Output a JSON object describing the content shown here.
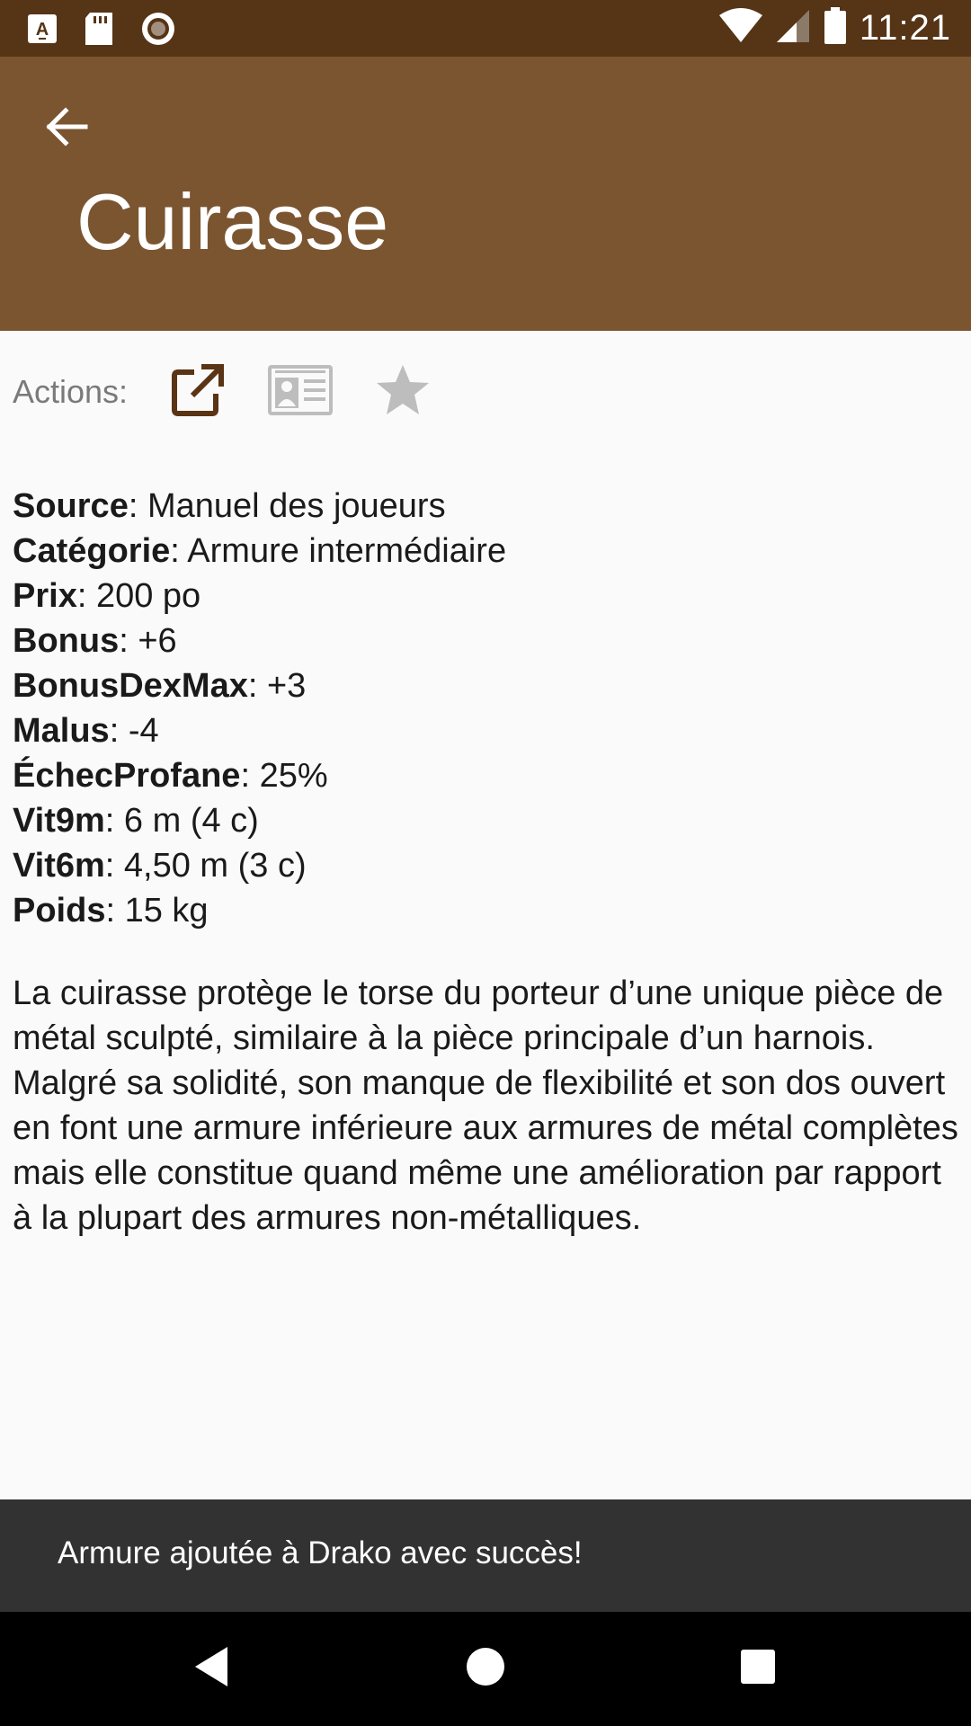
{
  "status_bar": {
    "time": "11:21",
    "left_icons": [
      "a-notification-icon",
      "sd-card-icon",
      "record-icon"
    ],
    "right_icons": [
      "wifi-icon",
      "signal-icon",
      "battery-icon"
    ]
  },
  "app_bar": {
    "title": "Cuirasse",
    "back_icon": "arrow-back-icon",
    "color": "#7b5530"
  },
  "actions": {
    "label": "Actions:",
    "buttons": [
      {
        "icon": "open-external-icon"
      },
      {
        "icon": "id-card-icon"
      },
      {
        "icon": "star-icon"
      }
    ]
  },
  "details": [
    {
      "label": "Source",
      "value": ": Manuel des joueurs"
    },
    {
      "label": "Catégorie",
      "value": ": Armure intermédiaire"
    },
    {
      "label": "Prix",
      "value": ": 200 po"
    },
    {
      "label": "Bonus",
      "value": ": +6"
    },
    {
      "label": "BonusDexMax",
      "value": ": +3"
    },
    {
      "label": "Malus",
      "value": ": -4"
    },
    {
      "label": "ÉchecProfane",
      "value": ": 25%"
    },
    {
      "label": "Vit9m",
      "value": ": 6 m (4 c)"
    },
    {
      "label": "Vit6m",
      "value": ": 4,50 m (3 c)"
    },
    {
      "label": "Poids",
      "value": ": 15 kg"
    }
  ],
  "description": "La cuirasse protège le torse du porteur d’une unique pièce de métal sculpté, similaire à la pièce principale d’un harnois. Malgré sa solidité, son manque de flexibilité et son dos ouvert en font une armure inférieure aux armures de métal complètes mais elle constitue quand même une amélioration par rapport à la plupart des armures non-métalliques.",
  "snackbar": {
    "message": "Armure ajoutée à Drako avec succès!"
  },
  "nav_bar": {
    "buttons": [
      "back-triangle-icon",
      "home-circle-icon",
      "recents-square-icon"
    ]
  }
}
